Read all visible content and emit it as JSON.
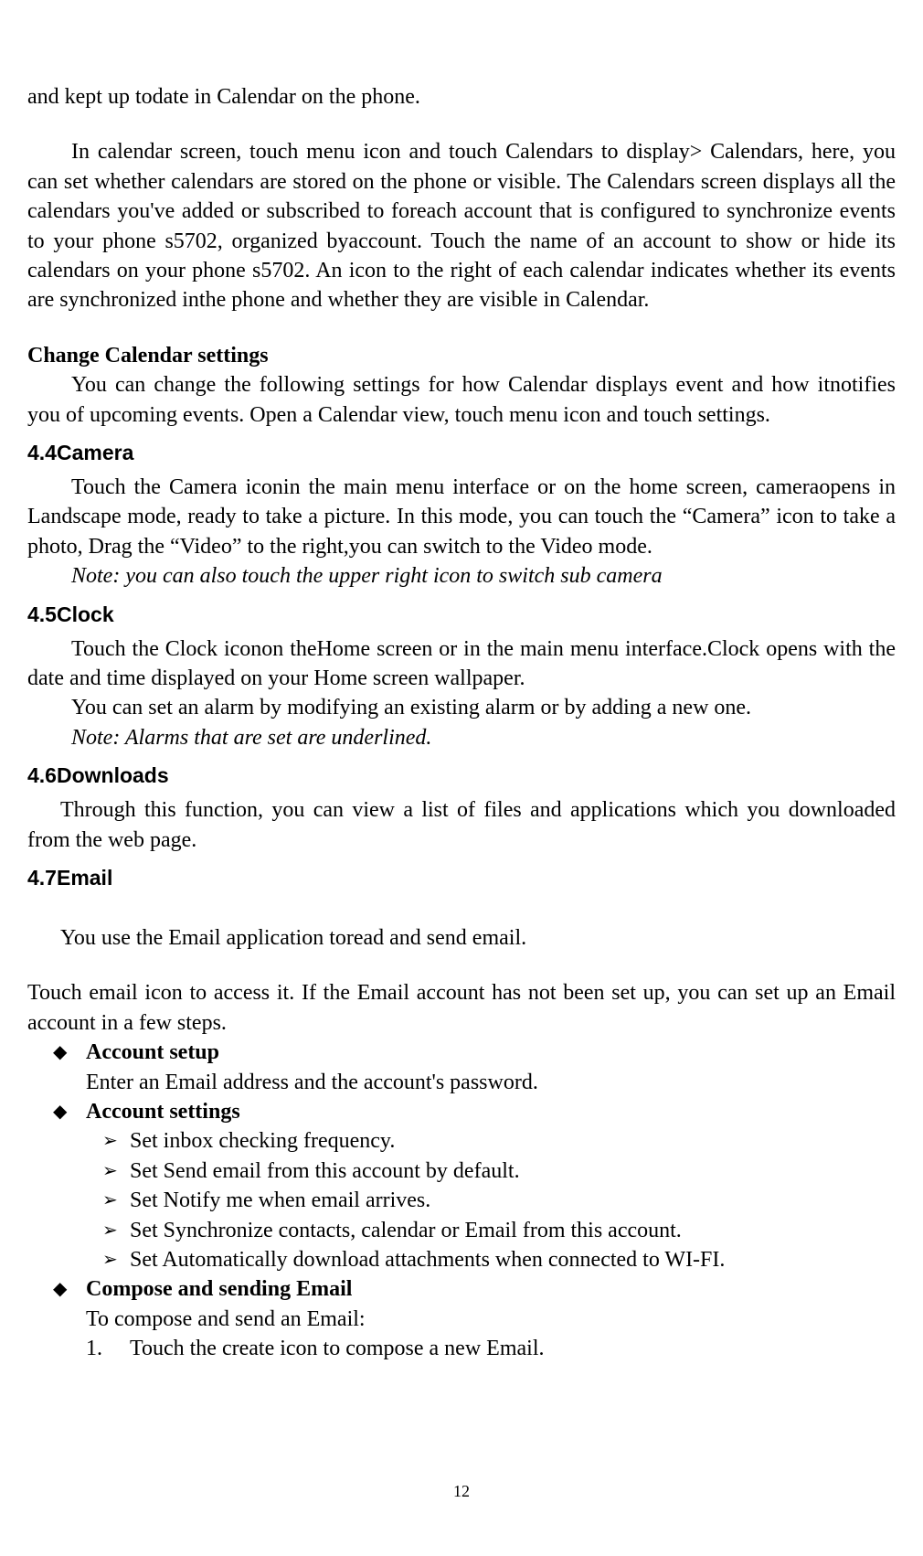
{
  "p_intro_continued": "and kept up todate in Calendar on the phone.",
  "p_calendar_main": "In calendar screen, touch menu icon and touch Calendars to display> Calendars, here, you can set whether calendars are stored on the phone or visible. The Calendars screen displays all the calendars you've added or subscribed to foreach account that is configured to synchronize events to your phone s5702, organized byaccount. Touch the name of an account to show or hide its calendars on your phone s5702. An icon to the right of each calendar indicates whether its events are synchronized inthe phone and whether they are visible in Calendar.",
  "h_change_calendar": "Change Calendar settings",
  "p_change_calendar": "You can change the following settings for how Calendar displays event and how itnotifies you of upcoming events. Open a Calendar view, touch menu icon and touch settings.",
  "s44_head": "4.4Camera",
  "s44_p1": "Touch the Camera iconin the main menu interface or on the home screen, cameraopens in Landscape mode, ready to take a picture. In this mode, you can touch the “Camera” icon to take a photo, Drag the “Video” to the right,you can switch to the Video mode.",
  "s44_note": "Note: you can also touch the upper right icon to switch sub camera",
  "s45_head": "4.5Clock",
  "s45_p1": "Touch the Clock iconon theHome screen or in the main menu interface.Clock opens with the date and time displayed on your Home screen wallpaper.",
  "s45_p2": "You can set an alarm by modifying an existing alarm or by adding a new one.",
  "s45_note": "Note: Alarms that are set are underlined.",
  "s46_head": "4.6Downloads",
  "s46_p1": "Through this function, you can view a list of files and applications which you downloaded from the web page.",
  "s47_head": "4.7Email",
  "s47_p1": "You use the Email application toread and send email.",
  "s47_p2": "Touch email icon to access it. If the Email account has not been set up, you can set up an Email account in a few steps.",
  "email_items": {
    "account_setup": {
      "label": "Account setup",
      "desc": "Enter an Email address and the account's password."
    },
    "account_settings": {
      "label": "Account settings",
      "subs": [
        "Set inbox checking frequency.",
        "Set Send email from this account by default.",
        "Set Notify me when email arrives.",
        "Set Synchronize contacts, calendar or Email from this account.",
        "Set Automatically download attachments when connected to WI-FI."
      ]
    },
    "compose_send": {
      "label": "Compose and sending Email",
      "desc": "To compose and send an Email:",
      "steps": [
        "Touch the create icon to compose a new Email."
      ]
    }
  },
  "page_number": "12"
}
